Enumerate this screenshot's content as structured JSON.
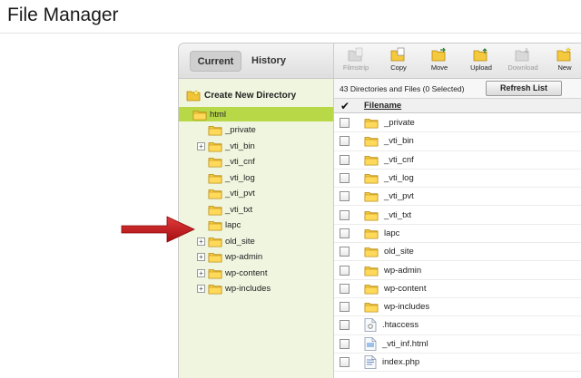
{
  "page": {
    "title": "File Manager"
  },
  "left_panel": {
    "tabs": [
      {
        "label": "Current",
        "active": true
      },
      {
        "label": "History",
        "active": false
      }
    ],
    "create_directory_label": "Create New Directory",
    "tree": [
      {
        "label": "html",
        "selected": true,
        "expandable": false,
        "depth": 0
      },
      {
        "label": "_private",
        "selected": false,
        "expandable": false,
        "depth": 1
      },
      {
        "label": "_vti_bin",
        "selected": false,
        "expandable": true,
        "depth": 1
      },
      {
        "label": "_vti_cnf",
        "selected": false,
        "expandable": false,
        "depth": 1
      },
      {
        "label": "_vti_log",
        "selected": false,
        "expandable": false,
        "depth": 1
      },
      {
        "label": "_vti_pvt",
        "selected": false,
        "expandable": false,
        "depth": 1
      },
      {
        "label": "_vti_txt",
        "selected": false,
        "expandable": false,
        "depth": 1
      },
      {
        "label": "lapc",
        "selected": false,
        "expandable": false,
        "depth": 1
      },
      {
        "label": "old_site",
        "selected": false,
        "expandable": true,
        "depth": 1
      },
      {
        "label": "wp-admin",
        "selected": false,
        "expandable": true,
        "depth": 1
      },
      {
        "label": "wp-content",
        "selected": false,
        "expandable": true,
        "depth": 1
      },
      {
        "label": "wp-includes",
        "selected": false,
        "expandable": true,
        "depth": 1
      }
    ]
  },
  "toolbar": {
    "buttons": [
      {
        "label": "Filmstrip",
        "icon": "filmstrip-icon",
        "disabled": true
      },
      {
        "label": "Copy",
        "icon": "copy-icon",
        "disabled": false
      },
      {
        "label": "Move",
        "icon": "move-icon",
        "disabled": false
      },
      {
        "label": "Upload",
        "icon": "upload-icon",
        "disabled": false
      },
      {
        "label": "Download",
        "icon": "download-icon",
        "disabled": true
      },
      {
        "label": "New",
        "icon": "new-folder-icon",
        "disabled": false
      }
    ]
  },
  "status": {
    "text": "43 Directories and Files (0 Selected)",
    "refresh_label": "Refresh List"
  },
  "file_list": {
    "column_filename": "Filename",
    "files": [
      {
        "name": "_private",
        "type": "folder"
      },
      {
        "name": "_vti_bin",
        "type": "folder"
      },
      {
        "name": "_vti_cnf",
        "type": "folder"
      },
      {
        "name": "_vti_log",
        "type": "folder"
      },
      {
        "name": "_vti_pvt",
        "type": "folder"
      },
      {
        "name": "_vti_txt",
        "type": "folder"
      },
      {
        "name": "lapc",
        "type": "folder"
      },
      {
        "name": "old_site",
        "type": "folder"
      },
      {
        "name": "wp-admin",
        "type": "folder"
      },
      {
        "name": "wp-content",
        "type": "folder"
      },
      {
        "name": "wp-includes",
        "type": "folder"
      },
      {
        "name": ".htaccess",
        "type": "config"
      },
      {
        "name": "_vti_inf.html",
        "type": "html"
      },
      {
        "name": "index.php",
        "type": "php"
      }
    ]
  },
  "colors": {
    "selected_row": "#b8d848",
    "left_panel_bg": "#f0f5df",
    "folder": "#f2c438",
    "annotation_arrow": "#c0161b"
  }
}
